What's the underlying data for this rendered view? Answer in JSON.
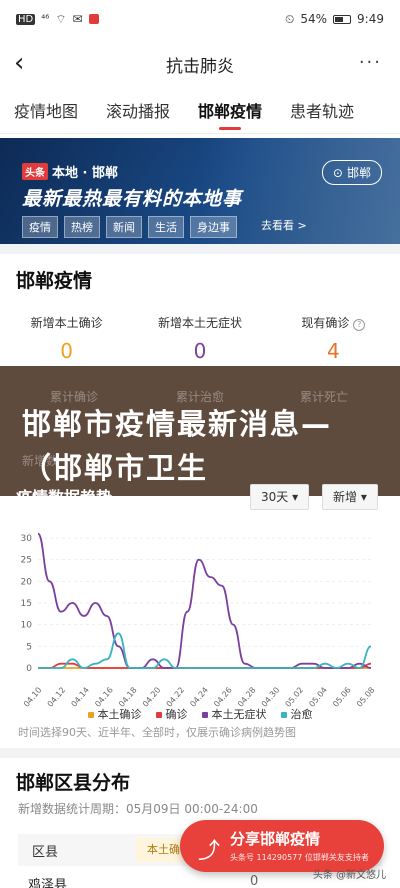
{
  "status": {
    "carrier": "HD",
    "signal": "⁴⁶",
    "battery": "54%",
    "time": "9:49"
  },
  "titlebar": {
    "title": "抗击肺炎"
  },
  "tabs": [
    "疫情地图",
    "滚动播报",
    "邯郸疫情",
    "患者轨迹"
  ],
  "banner": {
    "tt": "头条",
    "badge": "本地 · 邯郸",
    "headline": "最新最热最有料的本地事",
    "tags": [
      "疫情",
      "热榜",
      "新闻",
      "生活",
      "身边事"
    ],
    "more": "去看看 >",
    "location": "邯郸"
  },
  "section1": {
    "title": "邯郸疫情",
    "stats": [
      {
        "label": "新增本土确诊",
        "value": "0"
      },
      {
        "label": "新增本土无症状",
        "value": "0"
      },
      {
        "label": "现有确诊",
        "value": "4"
      }
    ],
    "stats2": [
      "累计确诊",
      "累计治愈",
      "累计死亡"
    ],
    "stats2_prefix": "新增数"
  },
  "overlay": {
    "text": "邯郸市疫情最新消息—（邯郸市卫生"
  },
  "trend": {
    "title": "疫情数据趋势",
    "range": "30天 ▾",
    "type": "新增 ▾"
  },
  "chart_data": {
    "type": "line",
    "x": [
      "04.10",
      "04.12",
      "04.14",
      "04.16",
      "04.18",
      "04.20",
      "04.22",
      "04.24",
      "04.26",
      "04.28",
      "04.30",
      "05.02",
      "05.04",
      "05.06",
      "05.08"
    ],
    "ylim": [
      0,
      30
    ],
    "yticks": [
      0,
      5,
      10,
      15,
      20,
      25,
      30
    ],
    "series": [
      {
        "name": "本土确诊",
        "color": "#f0a020",
        "values": [
          0,
          0,
          0,
          0,
          0,
          0,
          0,
          0,
          0,
          0,
          0,
          0,
          0,
          0,
          0,
          0,
          0,
          0,
          0,
          0,
          0,
          0,
          0,
          0,
          0,
          0,
          0,
          0,
          0,
          0
        ]
      },
      {
        "name": "确诊",
        "color": "#e23b3b",
        "values": [
          0,
          0,
          1,
          1,
          0,
          0,
          0,
          0,
          0,
          0,
          0,
          0,
          0,
          0,
          0,
          0,
          0,
          0,
          0,
          0,
          0,
          0,
          0,
          0,
          0,
          0,
          0,
          0,
          0,
          1
        ]
      },
      {
        "name": "本土无症状",
        "color": "#7b3fa0",
        "values": [
          31,
          20,
          13,
          15,
          12,
          15,
          12,
          5,
          0,
          0,
          2,
          0,
          0,
          13,
          25,
          21,
          19,
          10,
          1,
          0,
          0,
          0,
          0,
          1,
          1,
          0,
          0,
          0,
          1,
          0
        ]
      },
      {
        "name": "治愈",
        "color": "#3ab4c0",
        "values": [
          0,
          0,
          0,
          2,
          0,
          1,
          2,
          8,
          0,
          0,
          0,
          2,
          0,
          0,
          0,
          0,
          0,
          0,
          0,
          0,
          0,
          0,
          0,
          0,
          0,
          1,
          0,
          1,
          0,
          5
        ]
      }
    ]
  },
  "legend_colors": [
    "#f0a020",
    "#e23b3b",
    "#7b3fa0",
    "#3ab4c0"
  ],
  "note": "时间选择90天、近半年、全部时，仅展示确诊病例趋势图",
  "district": {
    "title": "邯郸区县分布",
    "subtitle": "新增数据统计周期：05月09日 00:00-24:00",
    "col1": "区县",
    "col2": "本土确诊",
    "row1_name": "鸡泽县",
    "row1_value": "0"
  },
  "fab": {
    "main": "分享邯郸疫情",
    "sub": "头条号 114290577 位邯郸关友支持者"
  },
  "watermark": "头条 @新文悠儿"
}
